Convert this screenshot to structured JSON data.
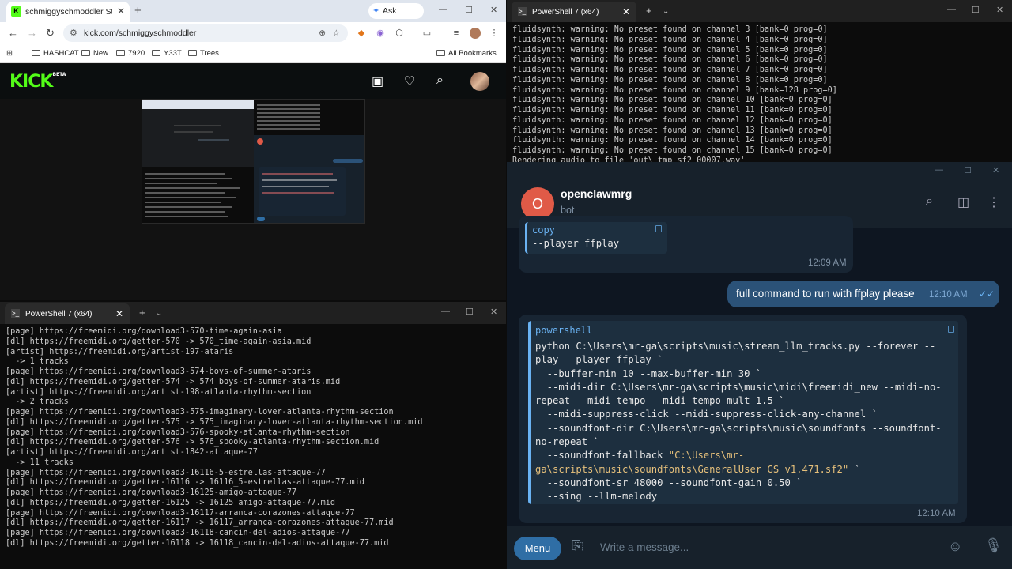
{
  "browser": {
    "tab_title": "schmiggyschmoddler Stream -",
    "tab_favicon": "K",
    "ask_gemini": "Ask Gemini",
    "url": "kick.com/schmiggyschmoddler",
    "bookmarks": [
      "HASHCAT",
      "New",
      "7920",
      "Y33T",
      "Trees"
    ],
    "all_bookmarks": "All Bookmarks",
    "site_logo": "KICK",
    "site_logo_badge": "BETA"
  },
  "ps_left": {
    "tab_title": "PowerShell 7 (x64)",
    "lines": [
      "[page] https://freemidi.org/download3-570-time-again-asia",
      "[dl] https://freemidi.org/getter-570 -> 570_time-again-asia.mid",
      "[artist] https://freemidi.org/artist-197-ataris",
      "  -> 1 tracks",
      "[page] https://freemidi.org/download3-574-boys-of-summer-ataris",
      "[dl] https://freemidi.org/getter-574 -> 574_boys-of-summer-ataris.mid",
      "[artist] https://freemidi.org/artist-198-atlanta-rhythm-section",
      "  -> 2 tracks",
      "[page] https://freemidi.org/download3-575-imaginary-lover-atlanta-rhythm-section",
      "[dl] https://freemidi.org/getter-575 -> 575_imaginary-lover-atlanta-rhythm-section.mid",
      "[page] https://freemidi.org/download3-576-spooky-atlanta-rhythm-section",
      "[dl] https://freemidi.org/getter-576 -> 576_spooky-atlanta-rhythm-section.mid",
      "[artist] https://freemidi.org/artist-1842-attaque-77",
      "  -> 11 tracks",
      "[page] https://freemidi.org/download3-16116-5-estrellas-attaque-77",
      "[dl] https://freemidi.org/getter-16116 -> 16116_5-estrellas-attaque-77.mid",
      "[page] https://freemidi.org/download3-16125-amigo-attaque-77",
      "[dl] https://freemidi.org/getter-16125 -> 16125_amigo-attaque-77.mid",
      "[page] https://freemidi.org/download3-16117-arranca-corazones-attaque-77",
      "[dl] https://freemidi.org/getter-16117 -> 16117_arranca-corazones-attaque-77.mid",
      "[page] https://freemidi.org/download3-16118-cancin-del-adios-attaque-77",
      "[dl] https://freemidi.org/getter-16118 -> 16118_cancin-del-adios-attaque-77.mid"
    ]
  },
  "ps_right": {
    "tab_title": "PowerShell 7 (x64)",
    "lines": [
      "fluidsynth: warning: No preset found on channel 3 [bank=0 prog=0]",
      "fluidsynth: warning: No preset found on channel 4 [bank=0 prog=0]",
      "fluidsynth: warning: No preset found on channel 5 [bank=0 prog=0]",
      "fluidsynth: warning: No preset found on channel 6 [bank=0 prog=0]",
      "fluidsynth: warning: No preset found on channel 7 [bank=0 prog=0]",
      "fluidsynth: warning: No preset found on channel 8 [bank=0 prog=0]",
      "fluidsynth: warning: No preset found on channel 9 [bank=128 prog=0]",
      "fluidsynth: warning: No preset found on channel 10 [bank=0 prog=0]",
      "fluidsynth: warning: No preset found on channel 11 [bank=0 prog=0]",
      "fluidsynth: warning: No preset found on channel 12 [bank=0 prog=0]",
      "fluidsynth: warning: No preset found on channel 13 [bank=0 prog=0]",
      "fluidsynth: warning: No preset found on channel 14 [bank=0 prog=0]",
      "fluidsynth: warning: No preset found on channel 15 [bank=0 prog=0]",
      "Rendering audio to file 'out\\_tmp_sf2_00007.wav'"
    ]
  },
  "telegram": {
    "avatar_letter": "O",
    "chat_name": "openclawmrg",
    "chat_status": "bot",
    "prev_code_lang": "copy",
    "prev_code": "--player ffplay",
    "prev_time": "12:09 AM",
    "out_text": "full command to run with ffplay please",
    "out_time": "12:10 AM",
    "code_lang": "powershell",
    "code_lines": [
      "python C:\\Users\\mr-ga\\scripts\\music\\stream_llm_tracks.py --forever --",
      "play --player ffplay `",
      "  --buffer-min 10 --max-buffer-min 30 `",
      "  --midi-dir C:\\Users\\mr-ga\\scripts\\music\\midi\\freemidi_new --midi-no-",
      "repeat --midi-tempo --midi-tempo-mult 1.5 `",
      "  --midi-suppress-click --midi-suppress-click-any-channel `",
      "  --soundfont-dir C:\\Users\\mr-ga\\scripts\\music\\soundfonts --soundfont-",
      "no-repeat `",
      "  --soundfont-fallback \"C:\\Users\\mr-",
      "ga\\scripts\\music\\soundfonts\\GeneralUser GS v1.471.sf2\" `",
      "  --soundfont-sr 48000 --soundfont-gain 0.50 `",
      "  --sing --llm-melody"
    ],
    "code_time": "12:10 AM",
    "menu_label": "Menu",
    "input_placeholder": "Write a message..."
  },
  "colors": {
    "kick_green": "#53fc18",
    "telegram_bg": "#0e1621",
    "telegram_out": "#2b5278",
    "terminal_bg": "#0c0c0c"
  }
}
